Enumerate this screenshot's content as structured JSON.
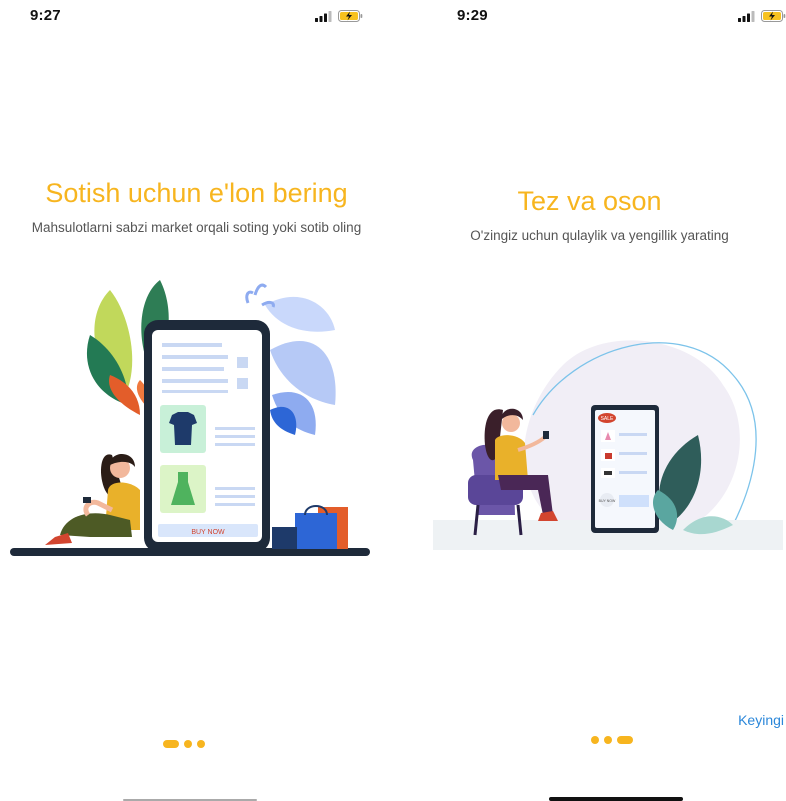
{
  "screens": [
    {
      "status_time": "9:27",
      "title": "Sotish uchun e'lon bering",
      "subtitle": "Mahsulotlarni sabzi market orqali soting yoki sotib oling",
      "buy_now_label": "BUY NOW",
      "active_dot": 0
    },
    {
      "status_time": "9:29",
      "title": "Tez va oson",
      "subtitle": "O'zingiz uchun qulaylik va yengillik yarating",
      "sale_label": "SALE",
      "buy_now_label": "BUY NOW",
      "next_label": "Keyingi",
      "active_dot": 2
    }
  ],
  "colors": {
    "accent": "#f7b51f",
    "link": "#2b87d9",
    "phone_dark": "#1e2a3a",
    "charging": "#f7c21f"
  },
  "icons": [
    "signal-icon",
    "battery-charging-icon"
  ]
}
